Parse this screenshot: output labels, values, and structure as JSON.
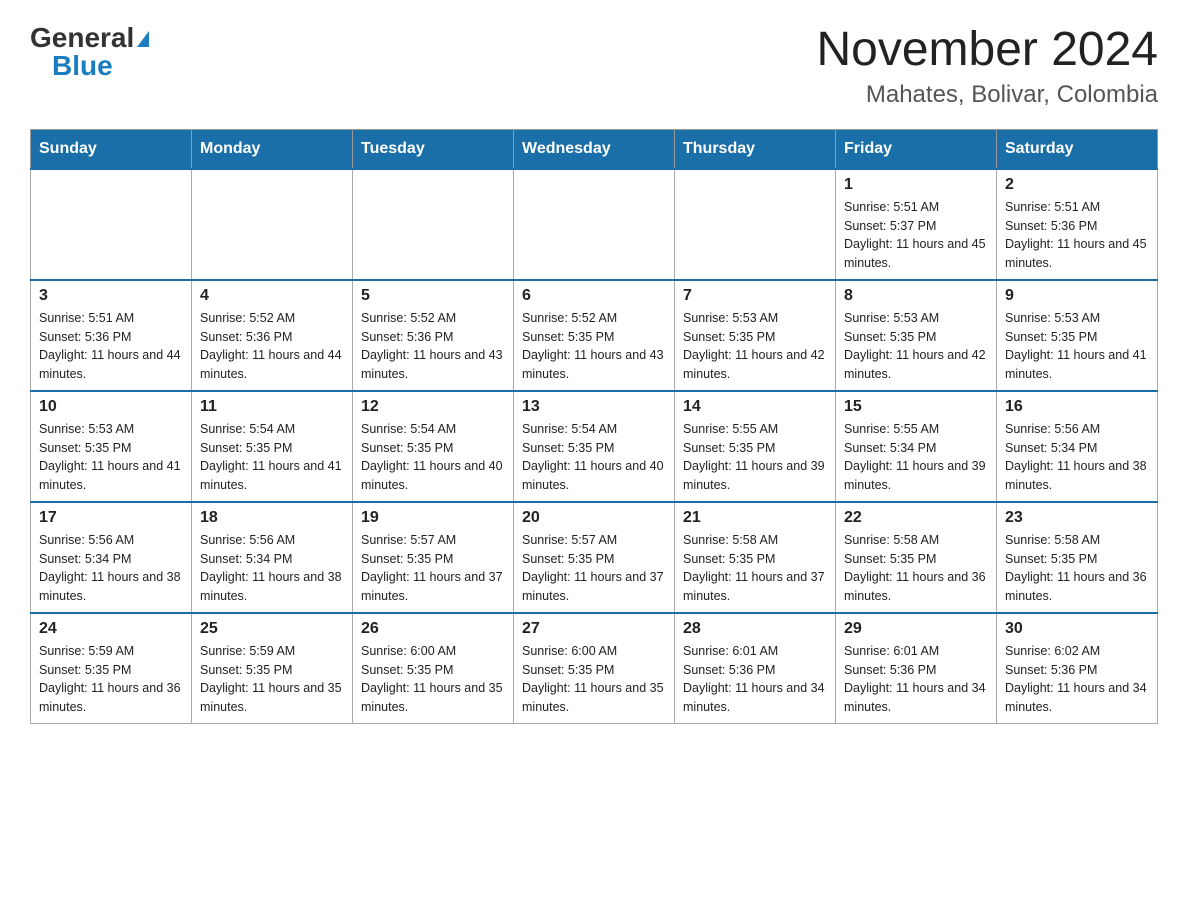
{
  "header": {
    "logo_general": "General",
    "logo_blue": "Blue",
    "title": "November 2024",
    "subtitle": "Mahates, Bolivar, Colombia"
  },
  "days_of_week": [
    "Sunday",
    "Monday",
    "Tuesday",
    "Wednesday",
    "Thursday",
    "Friday",
    "Saturday"
  ],
  "weeks": [
    [
      {
        "day": "",
        "sunrise": "",
        "sunset": "",
        "daylight": ""
      },
      {
        "day": "",
        "sunrise": "",
        "sunset": "",
        "daylight": ""
      },
      {
        "day": "",
        "sunrise": "",
        "sunset": "",
        "daylight": ""
      },
      {
        "day": "",
        "sunrise": "",
        "sunset": "",
        "daylight": ""
      },
      {
        "day": "",
        "sunrise": "",
        "sunset": "",
        "daylight": ""
      },
      {
        "day": "1",
        "sunrise": "Sunrise: 5:51 AM",
        "sunset": "Sunset: 5:37 PM",
        "daylight": "Daylight: 11 hours and 45 minutes."
      },
      {
        "day": "2",
        "sunrise": "Sunrise: 5:51 AM",
        "sunset": "Sunset: 5:36 PM",
        "daylight": "Daylight: 11 hours and 45 minutes."
      }
    ],
    [
      {
        "day": "3",
        "sunrise": "Sunrise: 5:51 AM",
        "sunset": "Sunset: 5:36 PM",
        "daylight": "Daylight: 11 hours and 44 minutes."
      },
      {
        "day": "4",
        "sunrise": "Sunrise: 5:52 AM",
        "sunset": "Sunset: 5:36 PM",
        "daylight": "Daylight: 11 hours and 44 minutes."
      },
      {
        "day": "5",
        "sunrise": "Sunrise: 5:52 AM",
        "sunset": "Sunset: 5:36 PM",
        "daylight": "Daylight: 11 hours and 43 minutes."
      },
      {
        "day": "6",
        "sunrise": "Sunrise: 5:52 AM",
        "sunset": "Sunset: 5:35 PM",
        "daylight": "Daylight: 11 hours and 43 minutes."
      },
      {
        "day": "7",
        "sunrise": "Sunrise: 5:53 AM",
        "sunset": "Sunset: 5:35 PM",
        "daylight": "Daylight: 11 hours and 42 minutes."
      },
      {
        "day": "8",
        "sunrise": "Sunrise: 5:53 AM",
        "sunset": "Sunset: 5:35 PM",
        "daylight": "Daylight: 11 hours and 42 minutes."
      },
      {
        "day": "9",
        "sunrise": "Sunrise: 5:53 AM",
        "sunset": "Sunset: 5:35 PM",
        "daylight": "Daylight: 11 hours and 41 minutes."
      }
    ],
    [
      {
        "day": "10",
        "sunrise": "Sunrise: 5:53 AM",
        "sunset": "Sunset: 5:35 PM",
        "daylight": "Daylight: 11 hours and 41 minutes."
      },
      {
        "day": "11",
        "sunrise": "Sunrise: 5:54 AM",
        "sunset": "Sunset: 5:35 PM",
        "daylight": "Daylight: 11 hours and 41 minutes."
      },
      {
        "day": "12",
        "sunrise": "Sunrise: 5:54 AM",
        "sunset": "Sunset: 5:35 PM",
        "daylight": "Daylight: 11 hours and 40 minutes."
      },
      {
        "day": "13",
        "sunrise": "Sunrise: 5:54 AM",
        "sunset": "Sunset: 5:35 PM",
        "daylight": "Daylight: 11 hours and 40 minutes."
      },
      {
        "day": "14",
        "sunrise": "Sunrise: 5:55 AM",
        "sunset": "Sunset: 5:35 PM",
        "daylight": "Daylight: 11 hours and 39 minutes."
      },
      {
        "day": "15",
        "sunrise": "Sunrise: 5:55 AM",
        "sunset": "Sunset: 5:34 PM",
        "daylight": "Daylight: 11 hours and 39 minutes."
      },
      {
        "day": "16",
        "sunrise": "Sunrise: 5:56 AM",
        "sunset": "Sunset: 5:34 PM",
        "daylight": "Daylight: 11 hours and 38 minutes."
      }
    ],
    [
      {
        "day": "17",
        "sunrise": "Sunrise: 5:56 AM",
        "sunset": "Sunset: 5:34 PM",
        "daylight": "Daylight: 11 hours and 38 minutes."
      },
      {
        "day": "18",
        "sunrise": "Sunrise: 5:56 AM",
        "sunset": "Sunset: 5:34 PM",
        "daylight": "Daylight: 11 hours and 38 minutes."
      },
      {
        "day": "19",
        "sunrise": "Sunrise: 5:57 AM",
        "sunset": "Sunset: 5:35 PM",
        "daylight": "Daylight: 11 hours and 37 minutes."
      },
      {
        "day": "20",
        "sunrise": "Sunrise: 5:57 AM",
        "sunset": "Sunset: 5:35 PM",
        "daylight": "Daylight: 11 hours and 37 minutes."
      },
      {
        "day": "21",
        "sunrise": "Sunrise: 5:58 AM",
        "sunset": "Sunset: 5:35 PM",
        "daylight": "Daylight: 11 hours and 37 minutes."
      },
      {
        "day": "22",
        "sunrise": "Sunrise: 5:58 AM",
        "sunset": "Sunset: 5:35 PM",
        "daylight": "Daylight: 11 hours and 36 minutes."
      },
      {
        "day": "23",
        "sunrise": "Sunrise: 5:58 AM",
        "sunset": "Sunset: 5:35 PM",
        "daylight": "Daylight: 11 hours and 36 minutes."
      }
    ],
    [
      {
        "day": "24",
        "sunrise": "Sunrise: 5:59 AM",
        "sunset": "Sunset: 5:35 PM",
        "daylight": "Daylight: 11 hours and 36 minutes."
      },
      {
        "day": "25",
        "sunrise": "Sunrise: 5:59 AM",
        "sunset": "Sunset: 5:35 PM",
        "daylight": "Daylight: 11 hours and 35 minutes."
      },
      {
        "day": "26",
        "sunrise": "Sunrise: 6:00 AM",
        "sunset": "Sunset: 5:35 PM",
        "daylight": "Daylight: 11 hours and 35 minutes."
      },
      {
        "day": "27",
        "sunrise": "Sunrise: 6:00 AM",
        "sunset": "Sunset: 5:35 PM",
        "daylight": "Daylight: 11 hours and 35 minutes."
      },
      {
        "day": "28",
        "sunrise": "Sunrise: 6:01 AM",
        "sunset": "Sunset: 5:36 PM",
        "daylight": "Daylight: 11 hours and 34 minutes."
      },
      {
        "day": "29",
        "sunrise": "Sunrise: 6:01 AM",
        "sunset": "Sunset: 5:36 PM",
        "daylight": "Daylight: 11 hours and 34 minutes."
      },
      {
        "day": "30",
        "sunrise": "Sunrise: 6:02 AM",
        "sunset": "Sunset: 5:36 PM",
        "daylight": "Daylight: 11 hours and 34 minutes."
      }
    ]
  ]
}
